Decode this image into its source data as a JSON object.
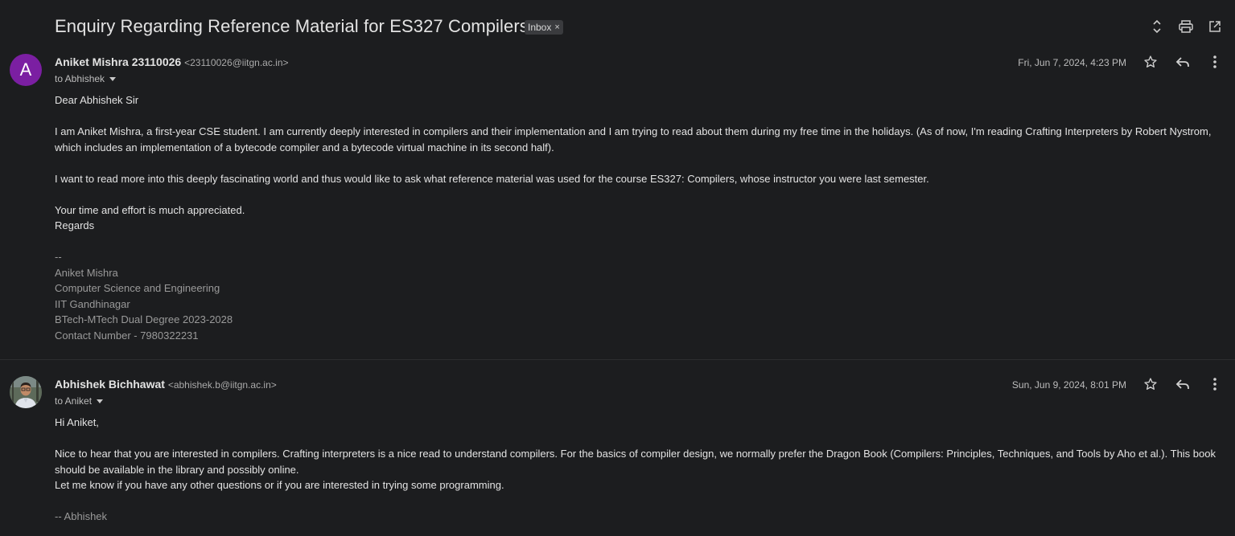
{
  "thread": {
    "subject": "Enquiry Regarding Reference Material for ES327 Compilers",
    "label": "Inbox",
    "label_remove": "×"
  },
  "toolbar_icons": [
    "expand-collapse-icon",
    "print-icon",
    "open-new-window-icon"
  ],
  "messages": [
    {
      "avatar_letter": "A",
      "avatar_color": "#7b1fa2",
      "sender_name": "Aniket Mishra 23110026",
      "sender_email": "<23110026@iitgn.ac.in>",
      "to": "to Abhishek",
      "date": "Fri, Jun 7, 2024, 4:23 PM",
      "greeting": "Dear Abhishek Sir",
      "para1": "I am Aniket Mishra, a first-year CSE student. I am currently deeply interested in compilers and their implementation and I am trying to read about them during my free time in the holidays. (As of now, I'm reading Crafting Interpreters by Robert Nystrom, which includes an implementation of a bytecode compiler and a bytecode virtual machine in its second half).",
      "para2": "I want to read more into this deeply fascinating world and thus would like to ask what reference material was used for the course ES327: Compilers, whose instructor you were last semester.",
      "para3_line1": "Your time and effort is much appreciated.",
      "para3_line2": "Regards",
      "signature": [
        "--",
        "Aniket Mishra",
        "Computer Science and Engineering",
        "IIT Gandhinagar",
        "BTech-MTech Dual Degree 2023-2028",
        "Contact Number - 7980322231"
      ]
    },
    {
      "avatar_image": "profile-photo",
      "sender_name": "Abhishek Bichhawat",
      "sender_email": "<abhishek.b@iitgn.ac.in>",
      "to": "to Aniket",
      "date": "Sun, Jun 9, 2024, 8:01 PM",
      "greeting": "Hi Aniket,",
      "para1": "Nice to hear that you are interested in compilers. Crafting interpreters is a nice read to understand compilers. For the basics of compiler design, we normally prefer the Dragon Book (Compilers: Principles, Techniques, and Tools by Aho et al.). This book should be available in the library and possibly online.",
      "para2": "Let me know if you have any other questions or if you are interested in trying some programming.",
      "signature": "-- Abhishek"
    }
  ],
  "message_icons": [
    "star-icon",
    "reply-icon",
    "more-vert-icon"
  ]
}
